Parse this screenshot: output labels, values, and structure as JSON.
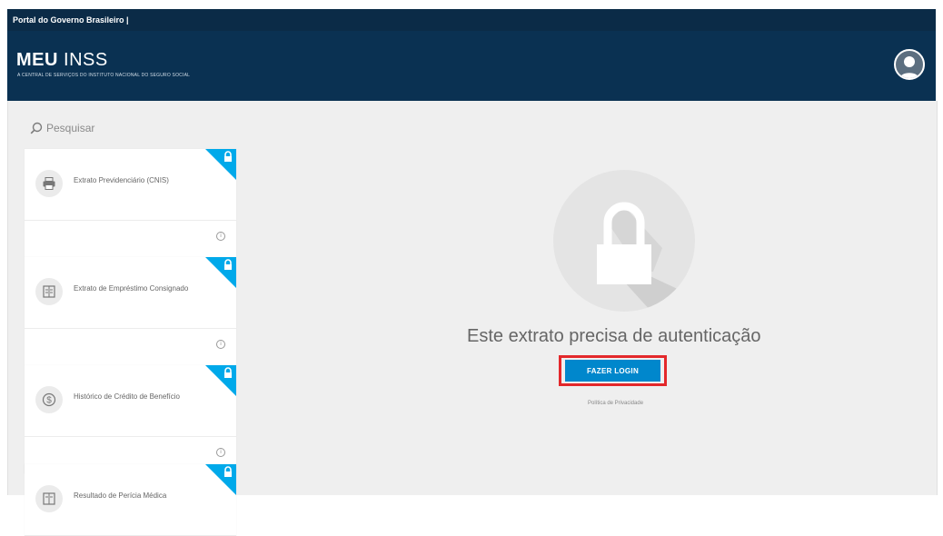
{
  "gov_bar": {
    "text": "Portal do Governo Brasileiro  |"
  },
  "header": {
    "logo_bold": "MEU",
    "logo_light": " INSS",
    "subtitle": "A CENTRAL DE SERVIÇOS DO INSTITUTO NACIONAL DO SEGURO SOCIAL"
  },
  "search": {
    "placeholder": "Pesquisar",
    "icon": "search-icon"
  },
  "cards": [
    {
      "title": "Extrato Previdenciário (CNIS)",
      "icon": "printer-icon"
    },
    {
      "title": "Extrato de Empréstimo Consignado",
      "icon": "document-icon"
    },
    {
      "title": "Histórico de Crédito de Benefício",
      "icon": "money-icon"
    },
    {
      "title": "Resultado de Perícia Médica",
      "icon": "document-icon"
    }
  ],
  "main": {
    "message": "Este extrato precisa de autenticação",
    "login_button": "FAZER LOGIN",
    "privacy": "Política de Privacidade"
  },
  "colors": {
    "gov_bar": "#0b2b47",
    "header": "#0a3152",
    "corner": "#00a9ea",
    "button": "#0087cc",
    "highlight": "#e3282b",
    "content_bg": "#efefef"
  }
}
